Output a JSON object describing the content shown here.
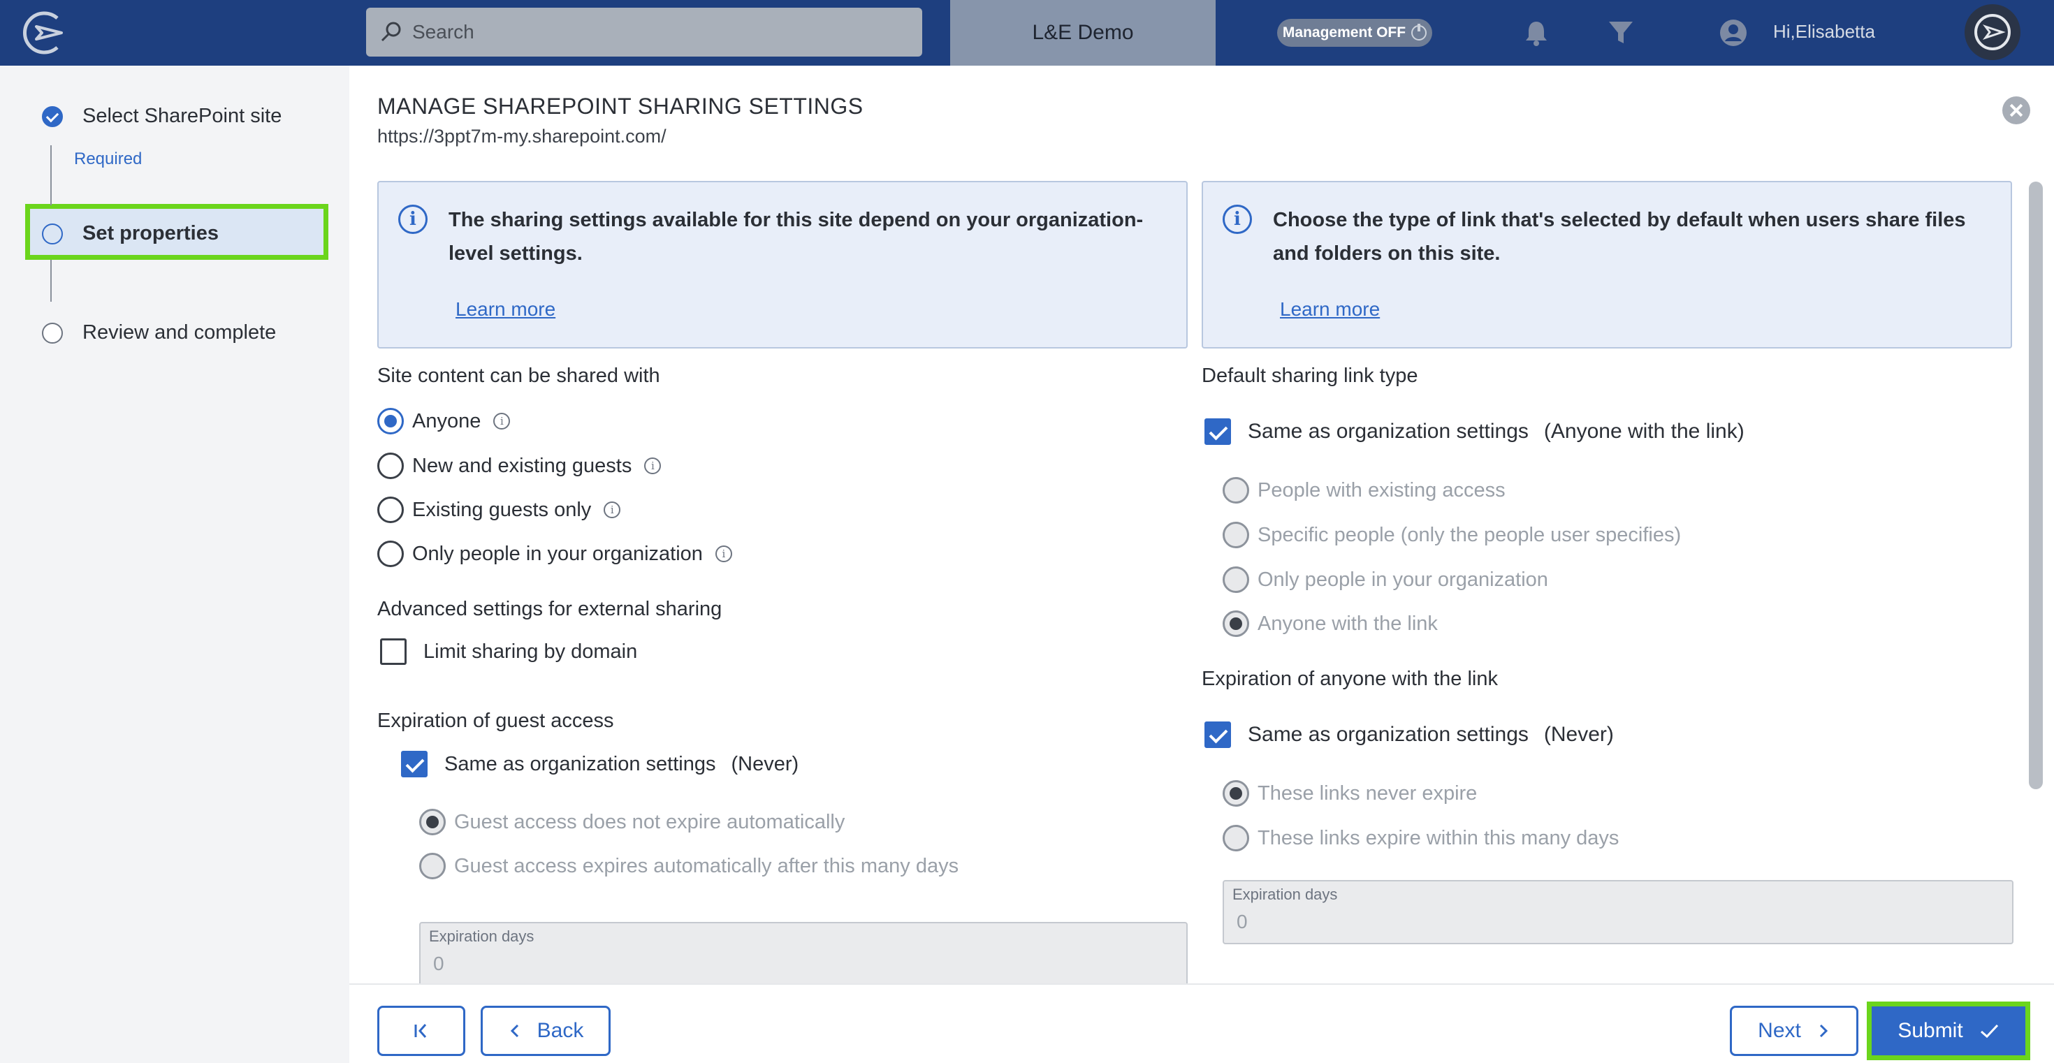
{
  "topbar": {
    "search_placeholder": "Search",
    "tenant": "L&E Demo",
    "management_toggle": "Management OFF",
    "greeting": "Hi,Elisabetta"
  },
  "sidebar": {
    "steps": [
      {
        "label": "Select SharePoint site",
        "state": "done",
        "note": "Required"
      },
      {
        "label": "Set properties",
        "state": "active"
      },
      {
        "label": "Review and complete",
        "state": "pending"
      }
    ]
  },
  "main": {
    "title": "MANAGE SHAREPOINT SHARING SETTINGS",
    "url": "https://3ppt7m-my.sharepoint.com/",
    "info_left": {
      "text": "The sharing settings available for this site depend on your organization-level settings.",
      "link": "Learn more"
    },
    "info_right": {
      "text": "Choose the type of link that's selected by default when users share files and folders on this site.",
      "link": "Learn more"
    },
    "share_with": {
      "heading": "Site content can be shared with",
      "options": [
        "Anyone",
        "New and existing guests",
        "Existing guests only",
        "Only people in your organization"
      ],
      "selected": "Anyone"
    },
    "advanced": {
      "heading": "Advanced settings for external sharing",
      "limit_domain": "Limit sharing by domain"
    },
    "guest_expiration": {
      "heading": "Expiration of guest access",
      "same_as_org": "Same as organization settings",
      "same_value": "(Never)",
      "options": [
        "Guest access does not expire automatically",
        "Guest access expires automatically after this many days"
      ],
      "field_label": "Expiration days",
      "field_value": "0"
    },
    "link_type": {
      "heading": "Default sharing link type",
      "same_as_org": "Same as organization settings",
      "same_value": "(Anyone with the link)",
      "options": [
        "People with existing access",
        "Specific people (only the people user specifies)",
        "Only people in your organization",
        "Anyone with the link"
      ],
      "selected": "Anyone with the link"
    },
    "anyone_expiration": {
      "heading": "Expiration of anyone with the link",
      "same_as_org": "Same as organization settings",
      "same_value": "(Never)",
      "options": [
        "These links never expire",
        "These links expire within this many days"
      ],
      "field_label": "Expiration days",
      "field_value": "0"
    }
  },
  "footer": {
    "first": "|<",
    "back": "Back",
    "next": "Next",
    "submit": "Submit"
  },
  "colors": {
    "topbar": "#1e3f7f",
    "accent": "#2f68c6",
    "highlight": "#6bd51c"
  }
}
